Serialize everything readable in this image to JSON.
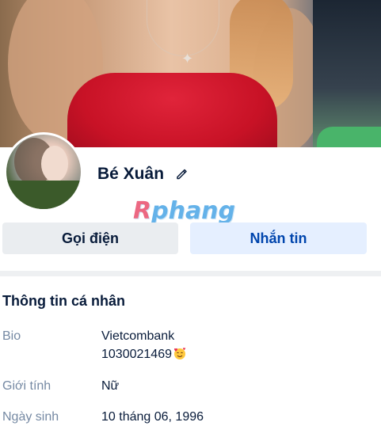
{
  "profile": {
    "name": "Bé Xuân",
    "watermark": {
      "first": "R",
      "rest": "phang"
    }
  },
  "actions": {
    "call_label": "Gọi điện",
    "message_label": "Nhắn tin"
  },
  "info": {
    "title": "Thông tin cá nhân",
    "rows": [
      {
        "label": "Bio",
        "value_line1": "Vietcombank",
        "value_line2": "1030021469",
        "emoji": "smiling-face-with-hearts-icon"
      },
      {
        "label": "Giới tính",
        "value": "Nữ"
      },
      {
        "label": "Ngày sinh",
        "value": "10 tháng 06, 1996"
      }
    ]
  },
  "colors": {
    "primary": "#0045ad",
    "text": "#081b3a",
    "muted": "#7589a3",
    "call_bg": "#eaedf0",
    "message_bg": "#e5efff"
  }
}
